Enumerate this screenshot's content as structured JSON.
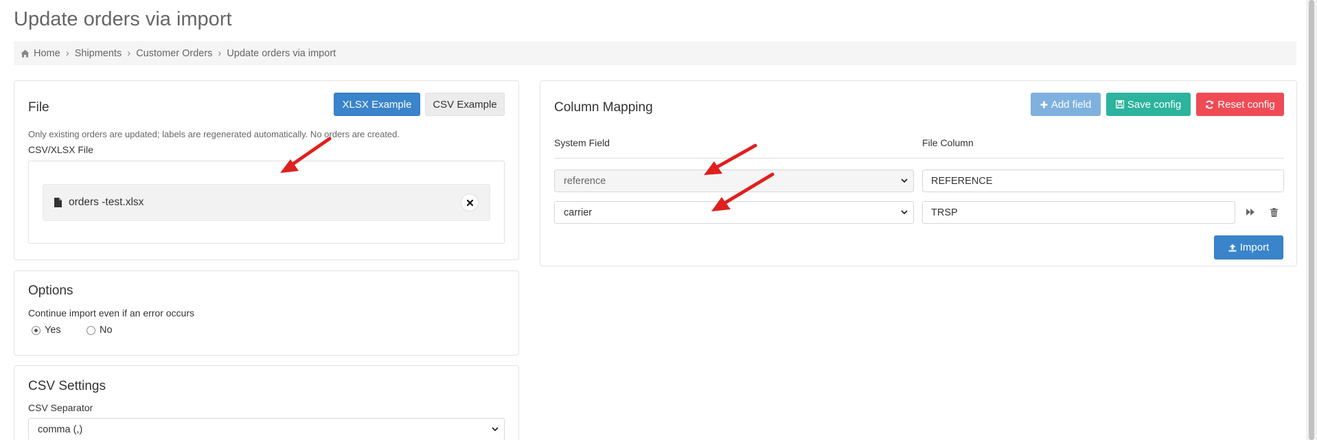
{
  "page": {
    "title": "Update orders via import"
  },
  "breadcrumb": [
    {
      "label": "Home",
      "icon": "home-icon"
    },
    {
      "label": "Shipments"
    },
    {
      "label": "Customer Orders"
    },
    {
      "label": "Update orders via import"
    }
  ],
  "file_card": {
    "title": "File",
    "xlsx_button": "XLSX Example",
    "csv_button": "CSV Example",
    "help": "Only existing orders are updated; labels are regenerated automatically. No orders are created.",
    "field_label": "CSV/XLSX File",
    "file_name": "orders -test.xlsx"
  },
  "options_card": {
    "title": "Options",
    "question": "Continue import even if an error occurs",
    "yes_label": "Yes",
    "no_label": "No",
    "selected": "Yes"
  },
  "csv_card": {
    "title": "CSV Settings",
    "separator_label": "CSV Separator",
    "separator_value": "comma (,)"
  },
  "mapping_card": {
    "title": "Column Mapping",
    "add_field": "Add field",
    "save_config": "Save config",
    "reset_config": "Reset config",
    "system_field_header": "System Field",
    "file_column_header": "File Column",
    "rows": [
      {
        "system_field": "reference",
        "file_column": "REFERENCE",
        "locked": true
      },
      {
        "system_field": "carrier",
        "file_column": "TRSP",
        "locked": false
      }
    ],
    "import_button": "Import"
  },
  "colors": {
    "primary": "#3a84cc",
    "teal": "#2db39e",
    "danger": "#ef4b55",
    "annotation_arrow": "#e0201e"
  }
}
